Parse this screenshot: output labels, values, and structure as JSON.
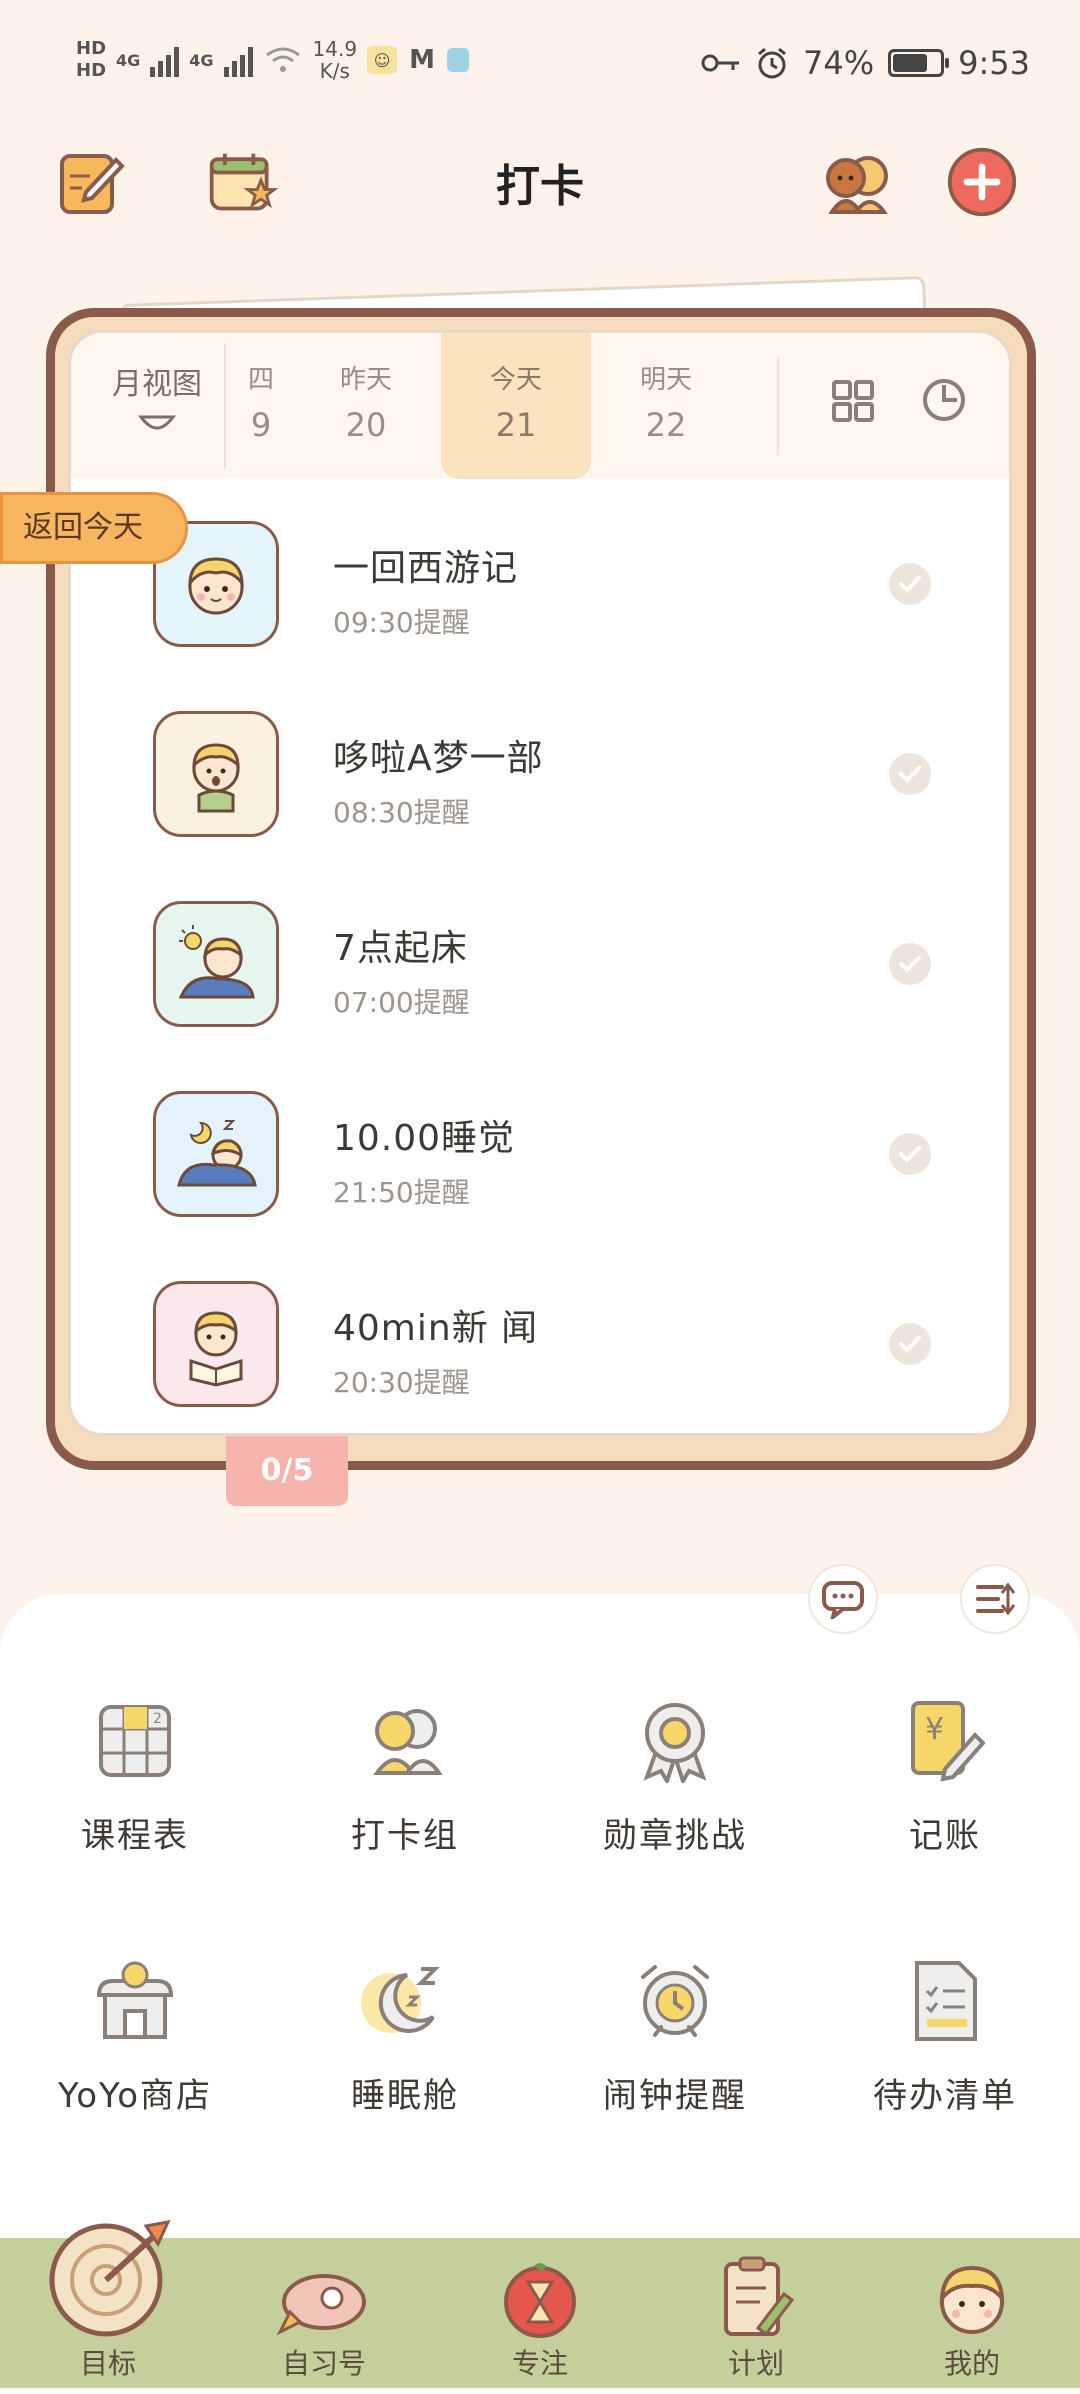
{
  "status_bar": {
    "hd1": "HD",
    "hd2": "HD",
    "net1": "4G",
    "net2": "4G",
    "speed_value": "14.9",
    "speed_unit": "K/s",
    "battery": "74%",
    "battery_level": 0.74,
    "time": "9:53"
  },
  "header": {
    "title": "打卡"
  },
  "date_bar": {
    "month_view": "月视图",
    "days": [
      {
        "weekday": "四",
        "day": "9"
      },
      {
        "weekday": "昨天",
        "day": "20"
      },
      {
        "weekday": "今天",
        "day": "21"
      },
      {
        "weekday": "明天",
        "day": "22"
      }
    ]
  },
  "return_today": "返回今天",
  "habits": [
    {
      "name": "一回西游记",
      "time": "09:30提醒",
      "bg": "#e3f4fb"
    },
    {
      "name": "哆啦A梦一部",
      "time": "08:30提醒",
      "bg": "#fbf1e0"
    },
    {
      "name": "7点起床",
      "time": "07:00提醒",
      "bg": "#e6f6ee"
    },
    {
      "name": "10.00睡觉",
      "time": "21:50提醒",
      "bg": "#e3f2fb"
    },
    {
      "name": "40min新 闻",
      "time": "20:30提醒",
      "bg": "#fbe8ec"
    }
  ],
  "progress": "0/5",
  "tools": [
    {
      "label": "课程表",
      "icon": "timetable-icon"
    },
    {
      "label": "打卡组",
      "icon": "group-icon"
    },
    {
      "label": "勋章挑战",
      "icon": "medal-icon"
    },
    {
      "label": "记账",
      "icon": "ledger-icon"
    },
    {
      "label": "YoYo商店",
      "icon": "shop-icon"
    },
    {
      "label": "睡眠舱",
      "icon": "sleep-icon"
    },
    {
      "label": "闹钟提醒",
      "icon": "alarm-icon"
    },
    {
      "label": "待办清单",
      "icon": "todo-icon"
    }
  ],
  "nav": [
    {
      "label": "目标",
      "icon": "target-icon"
    },
    {
      "label": "自习号",
      "icon": "rocket-icon"
    },
    {
      "label": "专注",
      "icon": "hourglass-icon"
    },
    {
      "label": "计划",
      "icon": "clipboard-icon"
    },
    {
      "label": "我的",
      "icon": "profile-icon"
    }
  ],
  "colors": {
    "background": "#fdf3ea",
    "card_border": "#8a5a4a",
    "today_highlight": "#fbe3bf",
    "return_badge": "#f8b661",
    "nav_bar": "#c5cf9c",
    "add_button": "#ef6a5e"
  }
}
